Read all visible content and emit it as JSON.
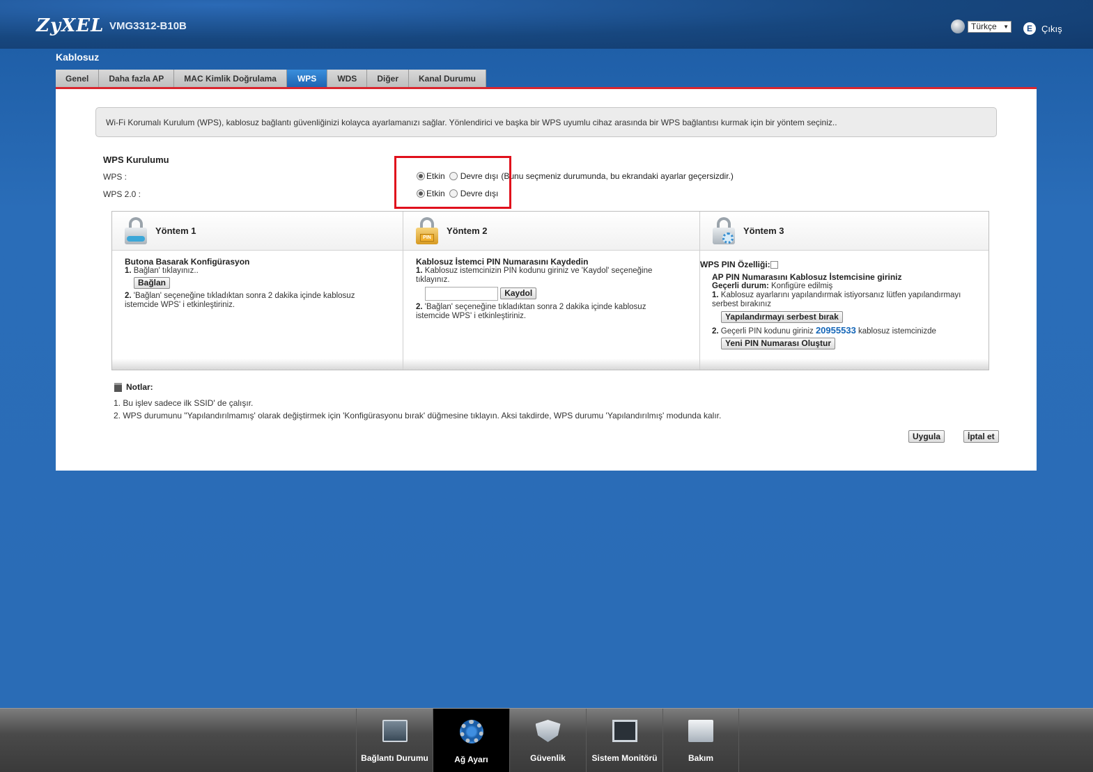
{
  "header": {
    "logo": "ZyXEL",
    "model": "VMG3312-B10B",
    "language": "Türkçe",
    "logout_label": "Çıkış"
  },
  "section_title": "Kablosuz",
  "tabs": [
    {
      "label": "Genel",
      "active": false
    },
    {
      "label": "Daha fazla AP",
      "active": false
    },
    {
      "label": "MAC Kimlik Doğrulama",
      "active": false
    },
    {
      "label": "WPS",
      "active": true
    },
    {
      "label": "WDS",
      "active": false
    },
    {
      "label": "Diğer",
      "active": false
    },
    {
      "label": "Kanal Durumu",
      "active": false
    }
  ],
  "info_text": "Wi-Fi Korumalı Kurulum (WPS), kablosuz bağlantı güvenliğinizi kolayca ayarlamanızı sağlar. Yönlendirici ve başka bir WPS uyumlu cihaz arasında bir WPS bağlantısı kurmak için bir yöntem seçiniz..",
  "wps_setup": {
    "title": "WPS Kurulumu",
    "wps_label": "WPS :",
    "wps2_label": "WPS 2.0 :",
    "enabled_label": "Etkin",
    "disabled_label": "Devre dışı",
    "wps_value": "enabled",
    "wps2_value": "enabled",
    "wps_note": "(Bunu seçmeniz durumunda, bu ekrandaki ayarlar geçersizdir.)"
  },
  "methods": {
    "m1": {
      "title": "Yöntem 1",
      "subtitle": "Butona Basarak Konfigürasyon",
      "step1_num": "1.",
      "step1": "Bağlan' tıklayınız..",
      "button": "Bağlan",
      "step2_num": "2.",
      "step2": "'Bağlan' seçeneğine tıkladıktan sonra 2 dakika içinde kablosuz istemcide WPS' i etkinleştiriniz."
    },
    "m2": {
      "title": "Yöntem 2",
      "subtitle": "Kablosuz İstemci PIN Numarasını Kaydedin",
      "step1_num": "1.",
      "step1": "Kablosuz istemcinizin PIN kodunu giriniz ve 'Kaydol' seçeneğine tıklayınız.",
      "pin_input": "",
      "button": "Kaydol",
      "step2_num": "2.",
      "step2": "'Bağlan' seçeneğine tıkladıktan sonra 2 dakika içinde kablosuz istemcide WPS' i etkinleştiriniz."
    },
    "m3": {
      "title": "Yöntem 3",
      "pin_feature_label": "WPS PIN Özelliği:",
      "pin_feature_checked": false,
      "subtitle": "AP PIN Numarasını Kablosuz İstemcisine giriniz",
      "status_label": "Geçerli durum:",
      "status_value": "Konfigüre edilmiş",
      "step1_num": "1.",
      "step1": "Kablosuz ayarlarını yapılandırmak istiyorsanız lütfen yapılandırmayı serbest bırakınız",
      "release_button": "Yapılandırmayı serbest bırak",
      "step2_num": "2.",
      "step2_prefix": "Geçerli PIN kodunu giriniz",
      "pin": "20955533",
      "step2_suffix": "kablosuz istemcinizde",
      "new_pin_button": "Yeni PIN Numarası Oluştur"
    }
  },
  "notes": {
    "title": "Notlar:",
    "items": [
      "1. Bu işlev sadece ilk SSID' de çalışır.",
      "2. WPS durumunu \"Yapılandırılmamış' olarak değiştirmek için 'Konfigürasyonu bırak' düğmesine tıklayın. Aksi takdirde, WPS durumu 'Yapılandırılmış' modunda kalır."
    ]
  },
  "actions": {
    "apply": "Uygula",
    "cancel": "İptal et"
  },
  "bottom_nav": [
    {
      "label": "Bağlantı Durumu",
      "icon": "monitor-globe-icon",
      "active": false
    },
    {
      "label": "Ağ Ayarı",
      "icon": "gear-globe-icon",
      "active": true
    },
    {
      "label": "Güvenlik",
      "icon": "shield-flame-icon",
      "active": false
    },
    {
      "label": "Sistem Monitörü",
      "icon": "chart-monitor-icon",
      "active": false
    },
    {
      "label": "Bakım",
      "icon": "tools-icon",
      "active": false
    }
  ]
}
